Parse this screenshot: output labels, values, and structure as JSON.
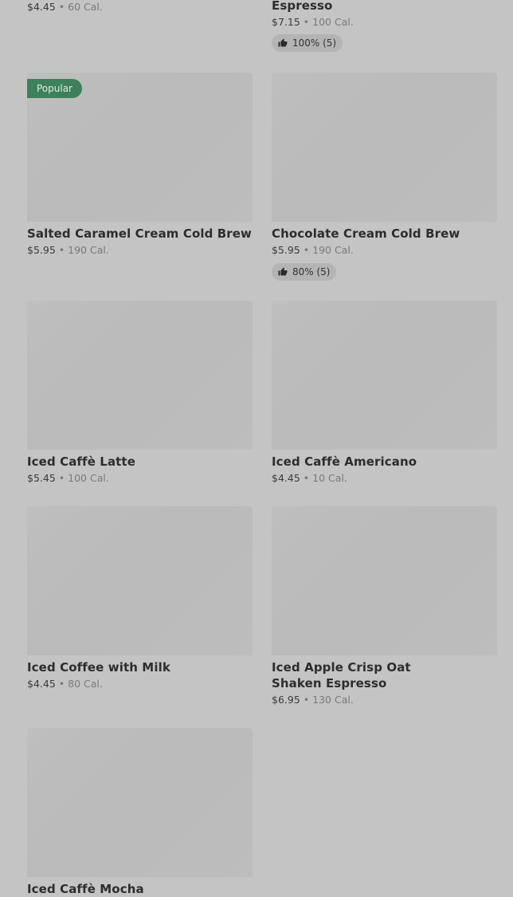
{
  "products": [
    {
      "price": "$4.45",
      "calories": "60 Cal."
    },
    {
      "name_partial": "Espresso",
      "price": "$7.15",
      "calories": "100 Cal.",
      "rating": "100% (5)"
    },
    {
      "name": "Salted Caramel Cream Cold Brew",
      "price": "$5.95",
      "calories": "190 Cal.",
      "badge": "Popular"
    },
    {
      "name": "Chocolate Cream Cold Brew",
      "price": "$5.95",
      "calories": "190 Cal.",
      "rating": "80% (5)"
    },
    {
      "name": "Iced Caffè Latte",
      "price": "$5.45",
      "calories": "100 Cal."
    },
    {
      "name": "Iced Caffè Americano",
      "price": "$4.45",
      "calories": "10 Cal."
    },
    {
      "name": "Iced Coffee with Milk",
      "price": "$4.45",
      "calories": "80 Cal."
    },
    {
      "name": "Iced Apple Crisp Oat Shaken Espresso",
      "price": "$6.95",
      "calories": "130 Cal."
    },
    {
      "name": "Iced Caffè Mocha"
    }
  ],
  "separator": "•",
  "colors": {
    "background": "#c4c4c4",
    "thumb": "#bcbcbc",
    "badge_bg": "#3d8059",
    "rating_bg": "#b4b4b4"
  },
  "icons": {
    "rating": "thumbs-up-icon"
  }
}
